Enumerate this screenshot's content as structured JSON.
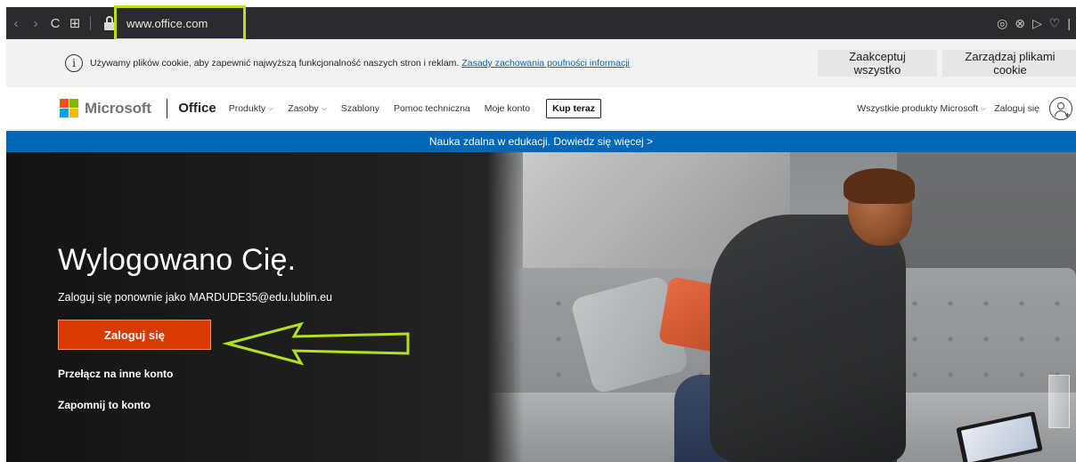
{
  "browser": {
    "url": "www.office.com",
    "back_glyph": "‹",
    "forward_glyph": "›",
    "reload_glyph": "C",
    "grid_glyph": "⊞",
    "right_icons": [
      "camera-icon",
      "shield-icon",
      "play-icon",
      "heart-icon"
    ],
    "right_glyphs": [
      "◎",
      "⊗",
      "▷",
      "♡",
      "|"
    ],
    "highlight_color": "#b4e01f"
  },
  "cookie_banner": {
    "info_glyph": "i",
    "text": "Używamy plików cookie, aby zapewnić najwyższą funkcjonalność naszych stron i reklam.",
    "link": "Zasady zachowania poufności informacji",
    "accept_label": "Zaakceptuj wszystko",
    "manage_label": "Zarządzaj plikami cookie"
  },
  "header": {
    "brand": "Microsoft",
    "logo_colors": [
      "#f25022",
      "#7fba00",
      "#00a4ef",
      "#ffb900"
    ],
    "product": "Office",
    "nav": [
      {
        "label": "Produkty",
        "chevron": "⌵"
      },
      {
        "label": "Zasoby",
        "chevron": "⌵"
      },
      {
        "label": "Szablony",
        "chevron": ""
      },
      {
        "label": "Pomoc techniczna",
        "chevron": ""
      },
      {
        "label": "Moje konto",
        "chevron": ""
      }
    ],
    "buy_label": "Kup teraz",
    "all_products": "Wszystkie produkty Microsoft",
    "all_products_chevron": "⌵",
    "signin_label": "Zaloguj się",
    "avatar_plus": "+"
  },
  "promo": {
    "text": "Nauka zdalna w edukacji. Dowiedz się więcej >",
    "color": "#0067b8"
  },
  "hero": {
    "title": "Wylogowano Cię.",
    "subtitle": "Zaloguj się ponownie jako MARDUDE35@edu.lublin.eu",
    "signin_button": "Zaloguj się",
    "switch_account": "Przełącz na inne konto",
    "forget_account": "Zapomnij to konto",
    "button_color": "#d83b01"
  },
  "annotation": {
    "arrow_color": "#b4e01f"
  }
}
